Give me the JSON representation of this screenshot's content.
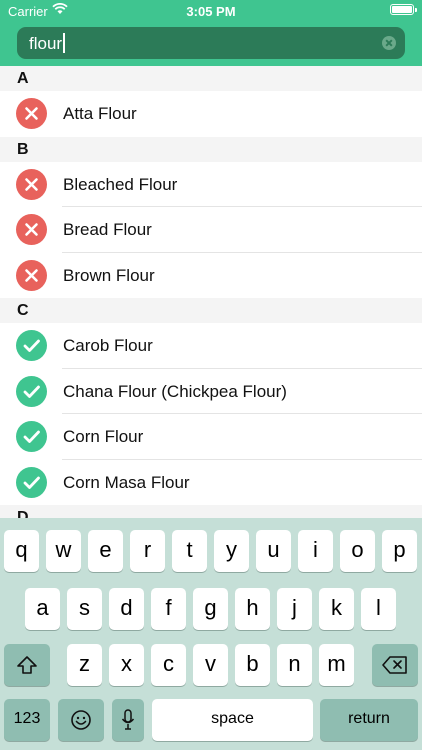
{
  "status_bar": {
    "carrier": "Carrier",
    "time": "3:05 PM"
  },
  "search": {
    "value": "flour"
  },
  "sections": [
    {
      "letter": "A",
      "items": [
        {
          "label": "Atta Flour",
          "status": "rejected"
        }
      ]
    },
    {
      "letter": "B",
      "items": [
        {
          "label": "Bleached Flour",
          "status": "rejected"
        },
        {
          "label": "Bread Flour",
          "status": "rejected"
        },
        {
          "label": "Brown Flour",
          "status": "rejected"
        }
      ]
    },
    {
      "letter": "C",
      "items": [
        {
          "label": "Carob Flour",
          "status": "approved"
        },
        {
          "label": "Chana Flour (Chickpea Flour)",
          "status": "approved"
        },
        {
          "label": "Corn Flour",
          "status": "approved"
        },
        {
          "label": "Corn Masa Flour",
          "status": "approved"
        }
      ]
    },
    {
      "letter": "D",
      "items": []
    }
  ],
  "colors": {
    "header": "#3fc590",
    "rejected": "#e8625c",
    "approved": "#3fc590",
    "keyboard": "#c5dfd7"
  },
  "keyboard": {
    "row1": [
      "q",
      "w",
      "e",
      "r",
      "t",
      "y",
      "u",
      "i",
      "o",
      "p"
    ],
    "row2": [
      "a",
      "s",
      "d",
      "f",
      "g",
      "h",
      "j",
      "k",
      "l"
    ],
    "row3": [
      "z",
      "x",
      "c",
      "v",
      "b",
      "n",
      "m"
    ],
    "numbers_label": "123",
    "space_label": "space",
    "return_label": "return",
    "icons": {
      "shift": "shift-icon",
      "delete": "backspace-icon",
      "emoji": "emoji-icon",
      "mic": "microphone-icon"
    }
  }
}
